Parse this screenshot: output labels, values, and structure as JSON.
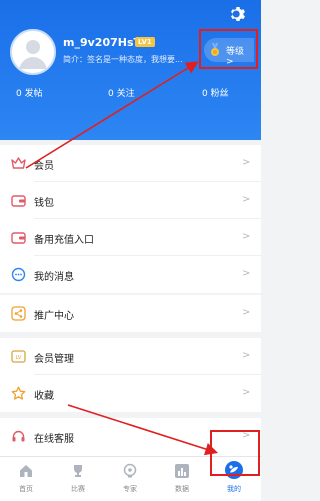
{
  "profile": {
    "username": "m_9v207HsT",
    "level_badge": "LV1",
    "bio": "简介：签名是一种态度，我想要...",
    "level_label": "等级 >"
  },
  "stats": [
    {
      "value": "0",
      "label": "发帖"
    },
    {
      "value": "0",
      "label": "关注"
    },
    {
      "value": "0",
      "label": "粉丝"
    }
  ],
  "menu": {
    "group1": [
      "会员",
      "钱包",
      "备用充值入口",
      "我的消息"
    ],
    "group2": [
      "推广中心"
    ],
    "group3": [
      "会员管理",
      "收藏"
    ],
    "group4": [
      "在线客服"
    ]
  },
  "tabs": [
    "首页",
    "比赛",
    "专家",
    "数据",
    "我的"
  ],
  "active_tab": "我的",
  "colors": {
    "accent": "#1a6fe8",
    "annotation": "#e02020",
    "badge": "#f4c542"
  }
}
